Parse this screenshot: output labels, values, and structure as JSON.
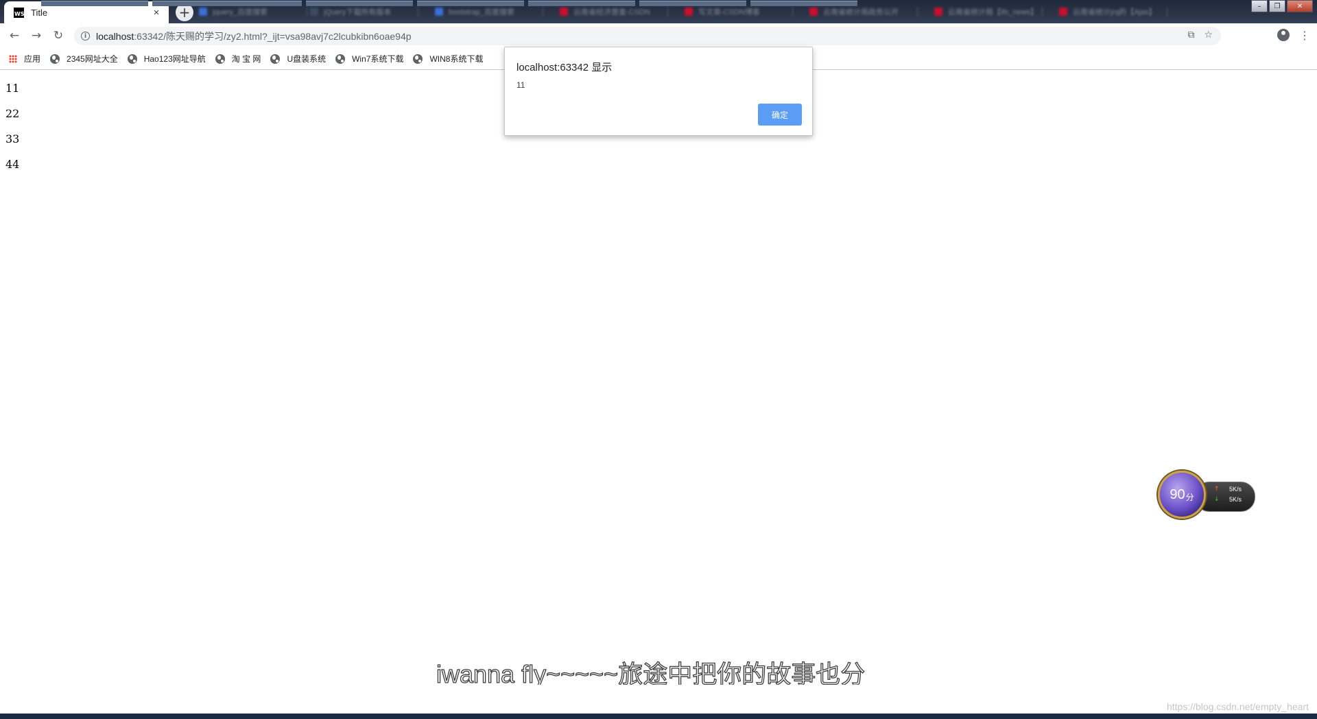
{
  "browser": {
    "active_tab": {
      "title": "Title",
      "icon": "webstorm-icon",
      "icon_text": "WS"
    },
    "background_tabs": [
      {
        "title": "jquery_百度搜索",
        "color": "#3a6fd8"
      },
      {
        "title": "jQuery下载所有版本",
        "color": "#3d4a60"
      },
      {
        "title": "bootstrap_百度搜索",
        "color": "#3a6fd8"
      },
      {
        "title": "云南省经济普查-CSDN",
        "color": "#c8102e"
      },
      {
        "title": "写文章-CSDN博客",
        "color": "#c8102e"
      },
      {
        "title": "云南省统计局政务公开",
        "color": "#c8102e"
      },
      {
        "title": "云南省统计局【ifo_news】",
        "color": "#c8102e"
      },
      {
        "title": "云南省统计jrq的【Ajax】",
        "color": "#c8102e"
      }
    ],
    "new_tab_symbol": "+",
    "tab_close_symbol": "×",
    "window_controls": {
      "minimize": "–",
      "maximize": "❐",
      "close": "✕"
    },
    "nav": {
      "back": "←",
      "forward": "→",
      "reload": "↻"
    },
    "url": {
      "host": "localhost",
      "rest": ":63342/陈天赐的学习/zy2.html?_ijt=vsa98avj7c2lcubkibn6oae94p"
    },
    "omnibox_icons": {
      "translate": "⧉",
      "star": "☆"
    },
    "menu_symbol": "⋮"
  },
  "bookmarks": [
    {
      "label": "应用",
      "icon": "apps-icon"
    },
    {
      "label": "2345网址大全",
      "icon": "globe-icon"
    },
    {
      "label": "Hao123网址导航",
      "icon": "globe-icon"
    },
    {
      "label": "淘 宝 网",
      "icon": "globe-icon"
    },
    {
      "label": "U盘装系统",
      "icon": "globe-icon"
    },
    {
      "label": "Win7系统下载",
      "icon": "globe-icon"
    },
    {
      "label": "WIN8系统下载",
      "icon": "globe-icon"
    }
  ],
  "page": {
    "lines": [
      "11",
      "22",
      "33",
      "44"
    ]
  },
  "dialog": {
    "title": "localhost:63342 显示",
    "message": "11",
    "ok_label": "确定"
  },
  "widget": {
    "score": "90",
    "score_unit": "分",
    "upload": {
      "arrow": "↑",
      "value": "5K/s",
      "color": "#ff6a2b"
    },
    "download": {
      "arrow": "↓",
      "value": "5K/s",
      "color": "#3ec43e"
    }
  },
  "lyrics": "iwanna fly~~~~~旅途中把你的故事也分",
  "watermark": "https://blog.csdn.net/empty_heart"
}
